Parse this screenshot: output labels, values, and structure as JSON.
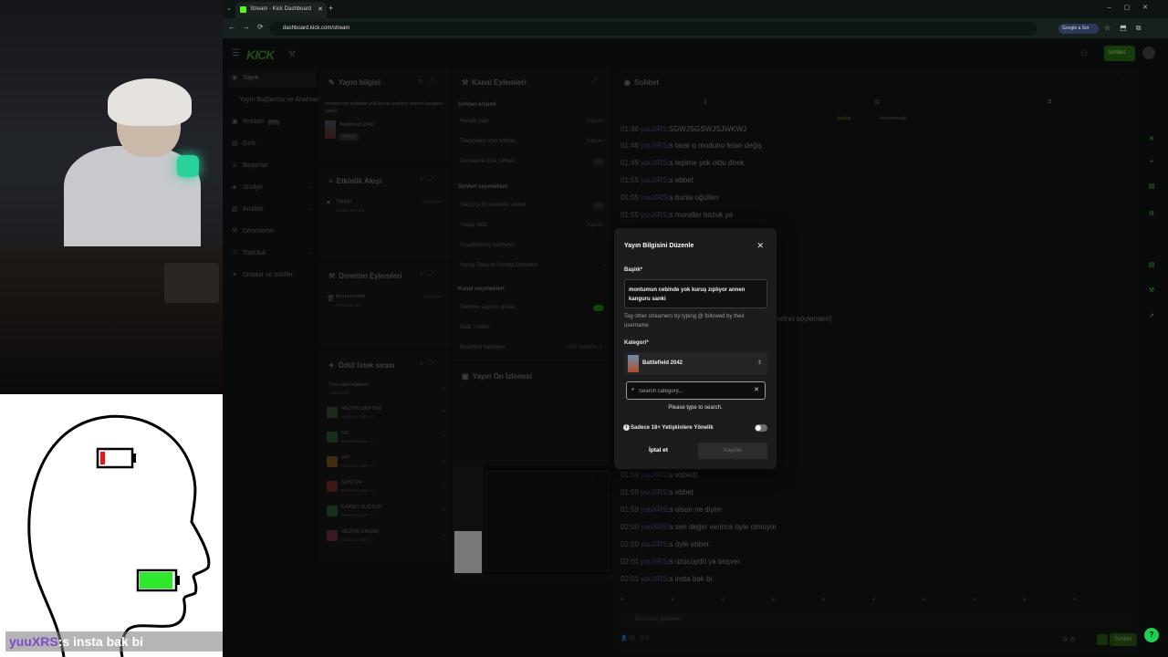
{
  "browser": {
    "tab_title": "Stream - Kick Dashboard",
    "url": "dashboard.kick.com/stream",
    "google_chip": "Google a Sor"
  },
  "app": {
    "logo": "KICK",
    "top_button": "Sohbet"
  },
  "sidebar": {
    "items": [
      {
        "label": "Yayın",
        "icon": "broadcast-icon"
      },
      {
        "label": "Yayın Bağlantısı ve Anahtarı",
        "icon": ""
      },
      {
        "label": "Reklam",
        "icon": "ad-icon",
        "badge": "Beta"
      },
      {
        "label": "Gelir",
        "icon": "money-icon"
      },
      {
        "label": "Başarılar",
        "icon": "trophy-icon"
      },
      {
        "label": "Stüdyo",
        "icon": "studio-icon"
      },
      {
        "label": "Analitik",
        "icon": "chart-icon"
      },
      {
        "label": "Denetleme",
        "icon": "hammer-icon"
      },
      {
        "label": "Topluluk",
        "icon": "community-icon"
      },
      {
        "label": "Droplar ve ödüller",
        "icon": "gift-icon"
      }
    ]
  },
  "stream_info": {
    "title": "Yayın bilgisi",
    "desc": "montumun cebinde yok kuruş zıplıyor annen kanguru sanki",
    "category": "Battlefield 2042",
    "tag": "Türkçe"
  },
  "activity": {
    "title": "Etkinlik Akışı",
    "item_name": "Takipçi",
    "item_sub": "Kanalı takip etti",
    "item_time": "4 saat önce"
  },
  "mod_actions": {
    "title": "Denetim Eylemleri",
    "item_name": "leyvanzmade",
    "item_sub": "bir mesajı sildi",
    "item_time": "1 gün önce"
  },
  "rewards": {
    "title": "Ödül İstek sırası",
    "all_label": "Tüm ödül istekleri",
    "all_sub": "1 istek aktif",
    "items": [
      {
        "name": "HEDİYE DEFTER",
        "sub": "Bekleyen istek · 0",
        "color": "#4a7a3a"
      },
      {
        "name": "GG",
        "sub": "Bekleyen istek · 0",
        "color": "#3a8a4a"
      },
      {
        "name": "VIP",
        "sub": "Bekleyen istek · 0",
        "color": "#b8862a"
      },
      {
        "name": "SUSTUR",
        "sub": "Bekleyen istek · 0",
        "color": "#b43a2a"
      },
      {
        "name": "KARŞIT SUSTUR",
        "sub": "Bekleyen istek · 0",
        "color": "#3a8a4a"
      },
      {
        "name": "HEDİYE KALEM",
        "sub": "Bekleyen istek · 0",
        "color": "#b43a5a"
      }
    ]
  },
  "channel_actions": {
    "title": "Kanal Eylemleri",
    "chat_access": "Sohbet erişimi",
    "rows1": [
      {
        "label": "Hesabı yaşı",
        "right": "Kapalı"
      },
      {
        "label": "Takipçilere özel sohbet",
        "right": "Kapalı"
      },
      {
        "label": "Abonelere özel sohbet",
        "right": ""
      }
    ],
    "chat_options": "Sohbet seçenekleri",
    "rows2": [
      {
        "label": "Yalnızca Emotelerle sohbet",
        "right": ""
      },
      {
        "label": "Yavaş mod",
        "right": "Kapalı"
      },
      {
        "label": "Yasaklanmış kelimeler",
        "right": ""
      },
      {
        "label": "Yapay Zeka ile Sohbet Denetimi",
        "right": ""
      }
    ],
    "channel_options": "Kanal seçenekleri",
    "rows3": [
      {
        "label": "İzlenme sayısını göster",
        "right": ""
      },
      {
        "label": "Raid Yönlen",
        "right": ""
      },
      {
        "label": "Hedefleri belirleyin",
        "right": "Aktif hedefler 1"
      }
    ]
  },
  "preview": {
    "title": "Yayın Ön İzlenesi"
  },
  "chat": {
    "title": "Sohbet",
    "pinned_users": [
      "bazilar",
      "leyvanzmade"
    ],
    "partial_line": "nefret söylemleri]",
    "lines": [
      {
        "ts": "01:46",
        "user": "yuuXRS",
        "msg": ":5GWJSGSWJSJWKWJ"
      },
      {
        "ts": "01:48",
        "user": "yuuXRS",
        "msg": ":s tarar o modunu felan değiş"
      },
      {
        "ts": "01:49",
        "user": "yuuXRS",
        "msg": ":s tepime yok oldu direk"
      },
      {
        "ts": "01:55",
        "user": "yuuXRS",
        "msg": ":s ebbet"
      },
      {
        "ts": "01:55",
        "user": "yuuXRS",
        "msg": ":s bunla oğullen"
      },
      {
        "ts": "01:55",
        "user": "yuuXRS",
        "msg": ":s moraller bozuk ya"
      },
      {
        "ts": "01:59",
        "user": "yuuXRS",
        "msg": ":s ebbettt"
      },
      {
        "ts": "01:59",
        "user": "yuuXRS",
        "msg": ":s ebbet"
      },
      {
        "ts": "01:59",
        "user": "yuuXRS",
        "msg": ":s olsun ne diyim"
      },
      {
        "ts": "02:00",
        "user": "yuuXRS",
        "msg": ":s sen değer verince öyle olmuyor"
      },
      {
        "ts": "02:00",
        "user": "yuuXRS",
        "msg": ":s öyle ebbet"
      },
      {
        "ts": "02:01",
        "user": "yuuXRS",
        "msg": ":s üzücüydü ya boşver"
      },
      {
        "ts": "02:01",
        "user": "yuuXRS",
        "msg": ":s insta bak bi"
      }
    ],
    "input_placeholder": "Bir mesaj gönderin",
    "send_label": "Sohbet",
    "viewer_count": "00",
    "follower_count": "0"
  },
  "modal": {
    "title": "Yayın Bilgisini Düzenle",
    "title_label": "Başlık*",
    "title_value": "montumun cebinde yok kuruş zıplıyor annen kanguru sanki",
    "hint": "Tag other streamers by typing @ followed by their username",
    "category_label": "Kategori*",
    "category_value": "Battlefield 2042",
    "search_placeholder": "Search category...",
    "please_type": "Please type to search.",
    "adult_label": "Sadece 18+ Yetişkinlere Yönelik",
    "cancel": "İptal et",
    "save": "Kaydet"
  },
  "overlay": {
    "chat_user": "yuuXRS",
    "chat_msg": ":s insta bak bi",
    "battery_head_level": 0.15,
    "battery_mouth_level": 0.95
  }
}
